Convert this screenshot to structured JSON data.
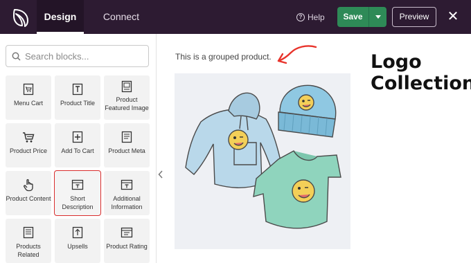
{
  "app": {
    "tabs": [
      {
        "label": "Design",
        "active": true
      },
      {
        "label": "Connect",
        "active": false
      }
    ],
    "help_label": "Help",
    "save_label": "Save",
    "preview_label": "Preview",
    "close_symbol": "✕"
  },
  "sidebar": {
    "search_placeholder": "Search blocks...",
    "blocks": [
      {
        "label": "Menu Cart",
        "icon": "menu-cart-icon"
      },
      {
        "label": "Product Title",
        "icon": "product-title-icon"
      },
      {
        "label": "Product Featured Image",
        "icon": "featured-image-icon"
      },
      {
        "label": "Product Price",
        "icon": "cart-icon"
      },
      {
        "label": "Add To Cart",
        "icon": "add-to-cart-icon"
      },
      {
        "label": "Product Meta",
        "icon": "product-meta-icon"
      },
      {
        "label": "Product Content",
        "icon": "hand-pointer-icon"
      },
      {
        "label": "Short Description",
        "icon": "short-description-icon",
        "selected": true
      },
      {
        "label": "Additional Information",
        "icon": "additional-info-icon"
      },
      {
        "label": "Products Related",
        "icon": "products-related-icon"
      },
      {
        "label": "Upsells",
        "icon": "upsells-icon"
      },
      {
        "label": "Product Rating",
        "icon": "product-rating-icon"
      }
    ]
  },
  "content": {
    "grouped_text": "This is a grouped product.",
    "overlay_title_line1": "Logo",
    "overlay_title_line2": "Collection"
  },
  "colors": {
    "topbar": "#2d1b32",
    "save": "#2e8a57",
    "highlight": "#d92d2d"
  }
}
